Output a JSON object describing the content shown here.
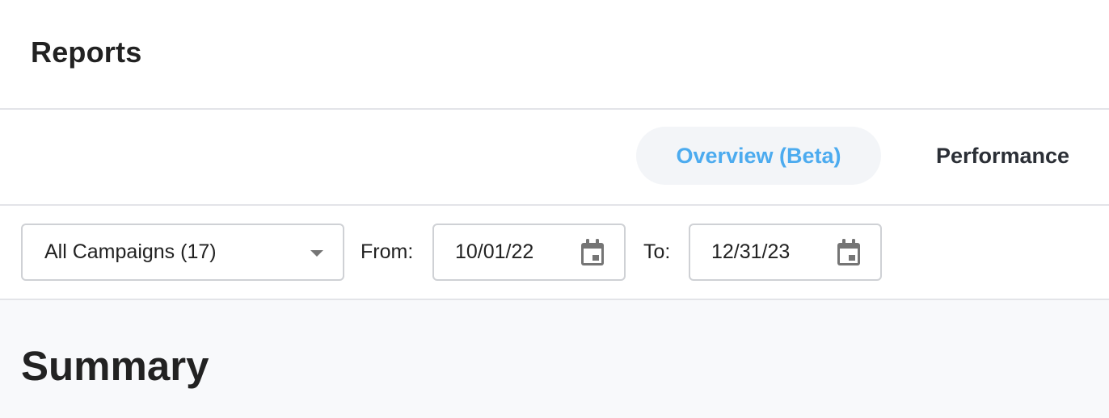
{
  "header": {
    "title": "Reports"
  },
  "tabs": [
    {
      "label": "Overview (Beta)",
      "active": true
    },
    {
      "label": "Performance",
      "active": false
    }
  ],
  "filters": {
    "campaign": {
      "selected": "All Campaigns (17)"
    },
    "from": {
      "label": "From:",
      "value": "10/01/22"
    },
    "to": {
      "label": "To:",
      "value": "12/31/23"
    }
  },
  "summary": {
    "title": "Summary"
  },
  "colors": {
    "accent": "#4cabef",
    "active_tab_bg": "#f3f5f8",
    "divider": "#e3e4e8",
    "summary_bg": "#f8f9fb"
  },
  "icons": {
    "campaign_dropdown": "chevron-down-icon",
    "date_picker": "calendar-icon"
  }
}
